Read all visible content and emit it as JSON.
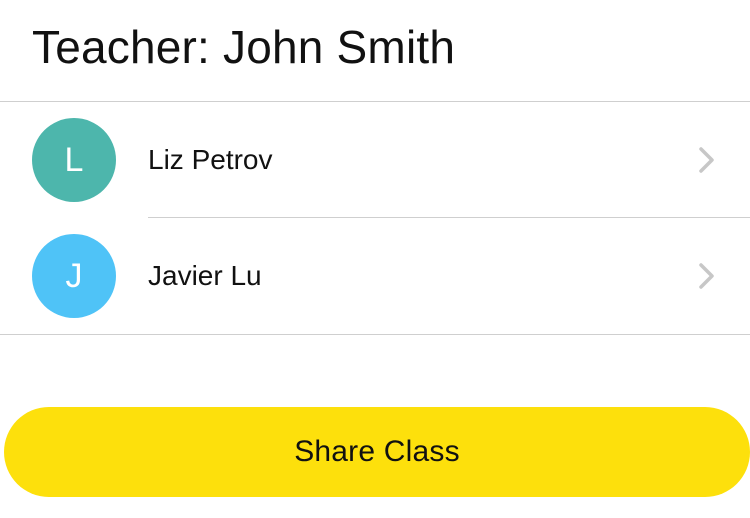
{
  "header": {
    "title": "Teacher: John Smith"
  },
  "students": [
    {
      "initial": "L",
      "name": "Liz Petrov",
      "avatar_color": "#4db6ac",
      "chevron_icon": "chevron-right-icon"
    },
    {
      "initial": "J",
      "name": "Javier Lu",
      "avatar_color": "#4fc3f7",
      "chevron_icon": "chevron-right-icon"
    }
  ],
  "actions": {
    "share_label": "Share Class",
    "share_color": "#fde00c"
  },
  "colors": {
    "divider": "#cfcfcf",
    "text": "#111111",
    "chevron": "#c7c7c7"
  }
}
